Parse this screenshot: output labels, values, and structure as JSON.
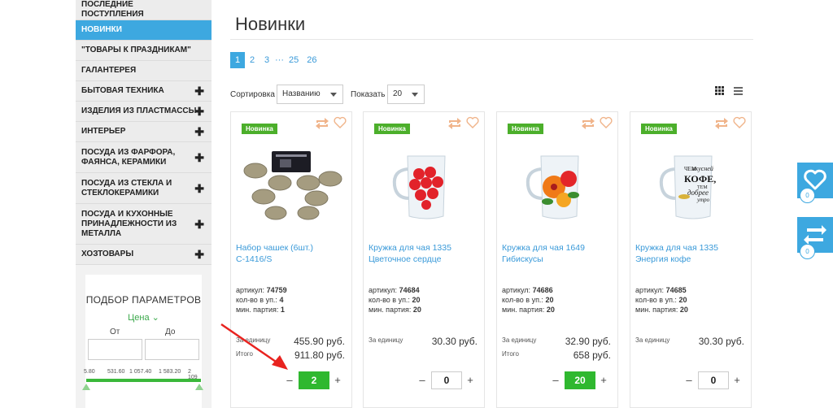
{
  "sidebar": {
    "items": [
      {
        "label": "ПОСЛЕДНИЕ ПОСТУПЛЕНИЯ",
        "active": false,
        "expandable": false
      },
      {
        "label": "НОВИНКИ",
        "active": true,
        "expandable": false
      },
      {
        "label": "\"ТОВАРЫ К ПРАЗДНИКАМ\"",
        "active": false,
        "expandable": false
      },
      {
        "label": "ГАЛАНТЕРЕЯ",
        "active": false,
        "expandable": false
      },
      {
        "label": "БЫТОВАЯ ТЕХНИКА",
        "active": false,
        "expandable": true
      },
      {
        "label": "ИЗДЕЛИЯ ИЗ ПЛАСТМАССЫ",
        "active": false,
        "expandable": true
      },
      {
        "label": "ИНТЕРЬЕР",
        "active": false,
        "expandable": true
      },
      {
        "label": "ПОСУДА ИЗ ФАРФОРА, ФАЯНСА, КЕРАМИКИ",
        "active": false,
        "expandable": true
      },
      {
        "label": "ПОСУДА ИЗ СТЕКЛА И СТЕКЛОКЕРАМИКИ",
        "active": false,
        "expandable": true
      },
      {
        "label": "ПОСУДА И КУХОННЫЕ ПРИНАДЛЕЖНОСТИ ИЗ МЕТАЛЛА",
        "active": false,
        "expandable": true
      },
      {
        "label": "ХОЗТОВАРЫ",
        "active": false,
        "expandable": true
      }
    ],
    "plus_symbol": "✚"
  },
  "filter": {
    "title": "ПОДБОР ПАРАМЕТРОВ",
    "price_toggle": "Цена ⌄",
    "from_label": "От",
    "to_label": "До",
    "scale": [
      "5.80",
      "531.60",
      "1 057.40",
      "1 583.20",
      "2 109"
    ]
  },
  "main": {
    "title": "Новинки",
    "pages": [
      "1",
      "2",
      "3",
      "···",
      "25",
      "26"
    ],
    "active_page": "1",
    "sort_label": "Сортировка",
    "sort_value": "Названию",
    "show_label": "Показать",
    "show_value": "20"
  },
  "products": [
    {
      "badge": "Новинка",
      "name": "Набор чашек (6шт.) С-1416/S",
      "art_label": "артикул:",
      "art": "74759",
      "pack_label": "кол-во в уп.:",
      "pack": "4",
      "min_label": "мин. партия:",
      "min": "1",
      "unit_label": "За единицу",
      "price": "455.90 руб.",
      "total_label": "Итого",
      "total": "911.80 руб.",
      "qty": "2",
      "qty_active": true
    },
    {
      "badge": "Новинка",
      "name": "Кружка для чая 1335 Цветочное сердце",
      "art_label": "артикул:",
      "art": "74684",
      "pack_label": "кол-во в уп.:",
      "pack": "20",
      "min_label": "мин. партия:",
      "min": "20",
      "unit_label": "За единицу",
      "price": "30.30 руб.",
      "total_label": "",
      "total": "",
      "qty": "0",
      "qty_active": false
    },
    {
      "badge": "Новинка",
      "name": "Кружка для чая 1649 Гибискусы",
      "art_label": "артикул:",
      "art": "74686",
      "pack_label": "кол-во в уп.:",
      "pack": "20",
      "min_label": "мин. партия:",
      "min": "20",
      "unit_label": "За единицу",
      "price": "32.90 руб.",
      "total_label": "Итого",
      "total": "658 руб.",
      "qty": "20",
      "qty_active": true
    },
    {
      "badge": "Новинка",
      "name": "Кружка для чая 1335 Энергия кофе",
      "art_label": "артикул:",
      "art": "74685",
      "pack_label": "кол-во в уп.:",
      "pack": "20",
      "min_label": "мин. партия:",
      "min": "20",
      "unit_label": "За единицу",
      "price": "30.30 руб.",
      "total_label": "",
      "total": "",
      "qty": "0",
      "qty_active": false
    }
  ],
  "mug_text": {
    "l1": "ЧЕМ",
    "l2": "вкусней",
    "l3": "КОФЕ,",
    "l4": "ТЕМ",
    "l5": "добрее",
    "l6": "утро"
  },
  "floating": {
    "favorites_count": "0",
    "compare_count": "0"
  },
  "colors": {
    "accent": "#3da8e0",
    "badge": "#4caf2b",
    "qty_active": "#2fb82f",
    "link": "#3a9ad9",
    "arrow": "#e8231f"
  }
}
